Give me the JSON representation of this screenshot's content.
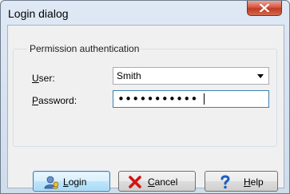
{
  "window": {
    "title": "Login dialog"
  },
  "group": {
    "label": "Permission authentication"
  },
  "user": {
    "label_accel": "U",
    "label_rest": "ser:",
    "value": "Smith"
  },
  "password": {
    "label_accel": "P",
    "label_rest": "assword:",
    "masked_value": "•••••••••••"
  },
  "buttons": {
    "login": {
      "accel": "L",
      "rest": "ogin",
      "icon": "user-key-icon"
    },
    "cancel": {
      "accel": "C",
      "rest": "ancel",
      "icon": "red-x-icon"
    },
    "help": {
      "accel": "H",
      "rest": "elp",
      "icon": "question-mark-icon"
    }
  },
  "colors": {
    "close_button": "#c23a22",
    "focus_border": "#3c7fb1",
    "help_icon": "#1a5fc0",
    "cancel_icon": "#d21414"
  }
}
